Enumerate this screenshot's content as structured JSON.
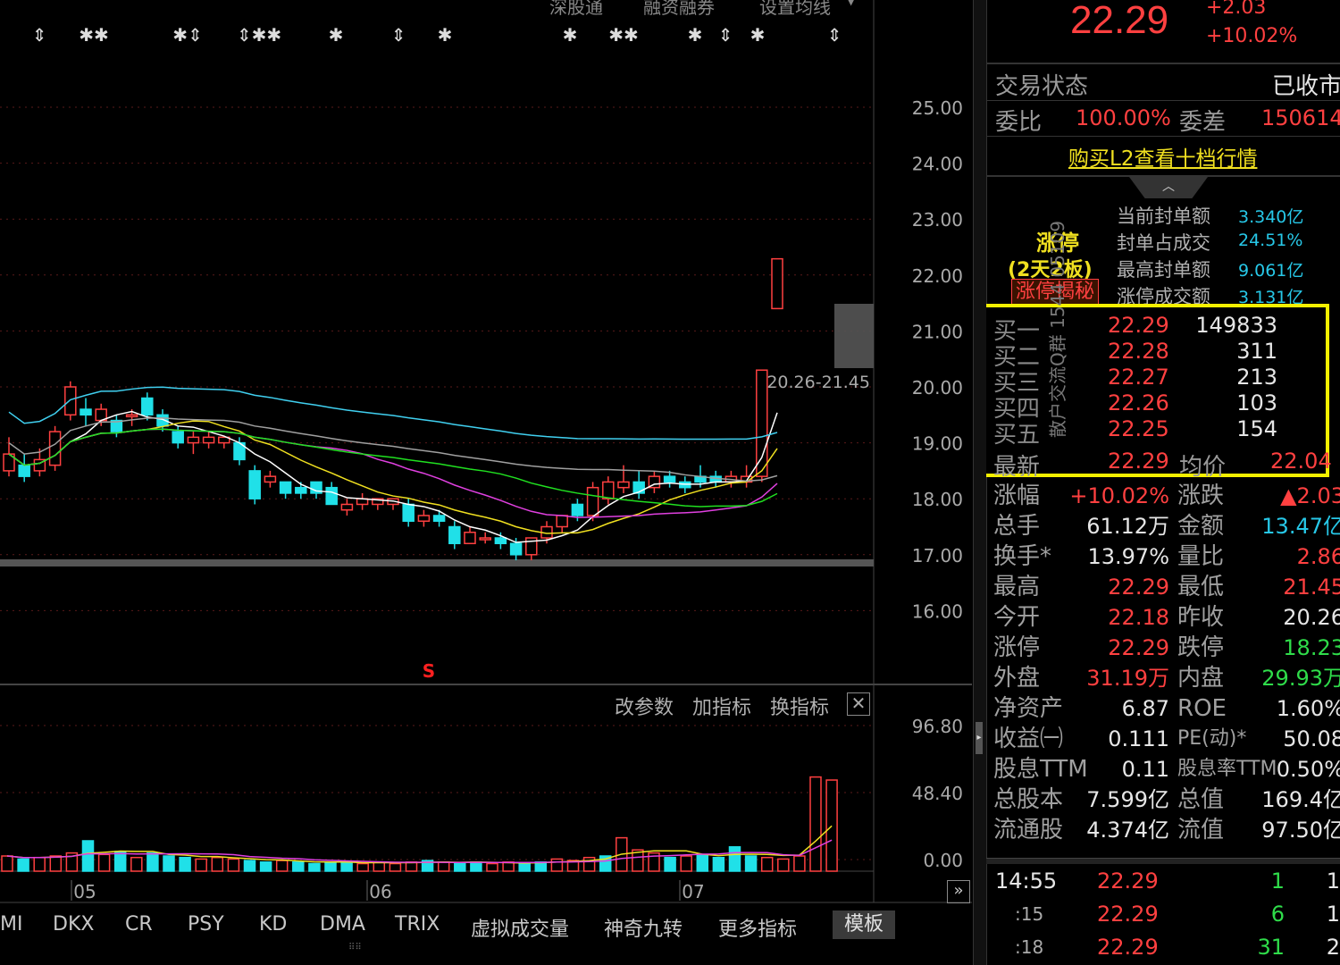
{
  "top_toolbar": {
    "items": [
      "深股通",
      "融资融券",
      "设置均线"
    ],
    "dropdown_icon": "triangle-down-icon"
  },
  "chart": {
    "price_axis": [
      "25.00",
      "24.00",
      "23.00",
      "22.00",
      "21.00",
      "20.00",
      "19.00",
      "18.00",
      "17.00",
      "16.00"
    ],
    "range_label": "20.26-21.45",
    "signal_mark": "S",
    "event_marks": [
      "⇕",
      "✱✱",
      "✱⇕",
      "⇕✱✱",
      "✱",
      "⇕",
      "✱",
      "✱",
      "✱✱",
      "✱",
      "⇕",
      "✱",
      "⇕"
    ],
    "candles": [
      [
        18.5,
        18.8,
        18.4,
        19.1
      ],
      [
        18.6,
        18.4,
        18.3,
        18.8
      ],
      [
        18.5,
        18.7,
        18.4,
        18.9
      ],
      [
        18.6,
        19.2,
        18.5,
        19.3
      ],
      [
        19.5,
        20.0,
        19.4,
        20.1
      ],
      [
        19.6,
        19.5,
        19.3,
        19.8
      ],
      [
        19.4,
        19.6,
        19.3,
        19.7
      ],
      [
        19.4,
        19.2,
        19.1,
        19.5
      ],
      [
        19.5,
        19.5,
        19.3,
        19.6
      ],
      [
        19.8,
        19.5,
        19.4,
        19.9
      ],
      [
        19.5,
        19.3,
        19.2,
        19.6
      ],
      [
        19.2,
        19.0,
        18.9,
        19.3
      ],
      [
        19.0,
        19.1,
        18.8,
        19.2
      ],
      [
        19.0,
        19.1,
        18.9,
        19.2
      ],
      [
        19.0,
        19.1,
        18.9,
        19.1
      ],
      [
        19.0,
        18.7,
        18.6,
        19.1
      ],
      [
        18.5,
        18.0,
        17.9,
        18.6
      ],
      [
        18.3,
        18.4,
        18.2,
        18.5
      ],
      [
        18.3,
        18.1,
        18.0,
        18.3
      ],
      [
        18.2,
        18.1,
        18.0,
        18.3
      ],
      [
        18.3,
        18.1,
        18.0,
        18.3
      ],
      [
        18.2,
        17.9,
        17.9,
        18.3
      ],
      [
        17.8,
        17.9,
        17.7,
        18.0
      ],
      [
        17.9,
        18.0,
        17.8,
        18.1
      ],
      [
        17.9,
        18.0,
        17.8,
        18.0
      ],
      [
        17.9,
        18.0,
        17.8,
        18.0
      ],
      [
        17.9,
        17.6,
        17.5,
        18.0
      ],
      [
        17.6,
        17.7,
        17.5,
        17.8
      ],
      [
        17.7,
        17.6,
        17.5,
        17.8
      ],
      [
        17.5,
        17.2,
        17.1,
        17.6
      ],
      [
        17.2,
        17.4,
        17.2,
        17.5
      ],
      [
        17.3,
        17.3,
        17.2,
        17.4
      ],
      [
        17.3,
        17.2,
        17.1,
        17.4
      ],
      [
        17.2,
        17.0,
        16.9,
        17.3
      ],
      [
        17.0,
        17.3,
        16.9,
        17.3
      ],
      [
        17.3,
        17.5,
        17.2,
        17.6
      ],
      [
        17.5,
        17.7,
        17.4,
        17.7
      ],
      [
        17.9,
        17.7,
        17.6,
        18.0
      ],
      [
        17.7,
        18.2,
        17.6,
        18.3
      ],
      [
        18.0,
        18.3,
        17.9,
        18.4
      ],
      [
        18.2,
        18.3,
        18.1,
        18.6
      ],
      [
        18.3,
        18.1,
        18.0,
        18.5
      ],
      [
        18.2,
        18.4,
        18.1,
        18.5
      ],
      [
        18.4,
        18.3,
        18.2,
        18.5
      ],
      [
        18.3,
        18.2,
        18.1,
        18.4
      ],
      [
        18.4,
        18.3,
        18.2,
        18.6
      ],
      [
        18.4,
        18.3,
        18.2,
        18.5
      ],
      [
        18.3,
        18.4,
        18.2,
        18.5
      ],
      [
        18.3,
        18.4,
        18.2,
        18.6
      ],
      [
        18.4,
        20.3,
        18.3,
        20.3
      ],
      [
        21.4,
        22.29,
        21.4,
        22.29
      ]
    ],
    "ma_colors": [
      "#ffffff",
      "#f0e020",
      "#e040e0",
      "#20e020",
      "#40d0f0",
      "#a0a0a0"
    ],
    "vol_axis": [
      "96.80",
      "48.40",
      "0.00"
    ],
    "vol_buttons": [
      "改参数",
      "加指标",
      "换指标"
    ],
    "volumes": [
      10,
      8,
      9,
      10,
      12,
      20,
      11,
      13,
      9,
      12,
      10,
      9,
      8,
      9,
      8,
      7,
      6,
      7,
      6,
      5,
      6,
      6,
      5,
      6,
      5,
      6,
      7,
      6,
      5,
      6,
      5,
      6,
      5,
      6,
      8,
      7,
      9,
      10,
      22,
      14,
      12,
      9,
      10,
      11,
      9,
      16,
      10,
      9,
      8,
      10,
      62,
      60
    ],
    "x_labels": [
      "05",
      "06",
      "07"
    ],
    "candle_colors": {
      "up": "#ff4040",
      "down": "#20e0e8"
    }
  },
  "bottom_tabs": [
    "MI",
    "DKX",
    "CR",
    "PSY",
    "KD",
    "DMA",
    "TRIX",
    "虚拟成交量",
    "神奇九转",
    "更多指标",
    "模板"
  ],
  "quote": {
    "price": "22.29",
    "change": "+2.03",
    "pct": "+10.02%",
    "trade_status_label": "交易状态",
    "trade_status": "已收市",
    "wb_label": "委比",
    "wb": "100.00%",
    "wc_label": "委差",
    "wc": "150614",
    "l2_link": "购买L2查看十档行情",
    "limit": {
      "title": "涨停",
      "days": "(2天2板)",
      "reveal_button": "涨停揭秘",
      "rows": [
        {
          "label": "当前封单额",
          "value": "3.340亿"
        },
        {
          "label": "封单占成交",
          "value": "24.51%"
        },
        {
          "label": "最高封单额",
          "value": "9.061亿"
        },
        {
          "label": "涨停成交额",
          "value": "3.131亿"
        }
      ]
    },
    "vertical_note": "散户交流Q群 1544 05109",
    "bids": [
      {
        "label": "买一",
        "price": "22.29",
        "vol": "149833"
      },
      {
        "label": "买二",
        "price": "22.28",
        "vol": "311"
      },
      {
        "label": "买三",
        "price": "22.27",
        "vol": "213"
      },
      {
        "label": "买四",
        "price": "22.26",
        "vol": "103"
      },
      {
        "label": "买五",
        "price": "22.25",
        "vol": "154"
      }
    ],
    "latest_label": "最新",
    "latest": "22.29",
    "avg_label": "均价",
    "avg": "22.04",
    "stats": [
      {
        "l1": "涨幅",
        "v1": "+10.02%",
        "c1": "r",
        "l2": "涨跌",
        "v2": "▲2.03",
        "c2": "r"
      },
      {
        "l1": "总手",
        "v1": "61.12万",
        "c1": "w",
        "l2": "金额",
        "v2": "13.47亿",
        "c2": "c"
      },
      {
        "l1": "换手*",
        "v1": "13.97%",
        "c1": "w",
        "l2": "量比",
        "v2": "2.86",
        "c2": "r"
      },
      {
        "l1": "最高",
        "v1": "22.29",
        "c1": "r",
        "l2": "最低",
        "v2": "21.45",
        "c2": "r"
      },
      {
        "l1": "今开",
        "v1": "22.18",
        "c1": "r",
        "l2": "昨收",
        "v2": "20.26",
        "c2": "w"
      },
      {
        "l1": "涨停",
        "v1": "22.29",
        "c1": "r",
        "l2": "跌停",
        "v2": "18.23",
        "c2": "g"
      },
      {
        "l1": "外盘",
        "v1": "31.19万",
        "c1": "r",
        "l2": "内盘",
        "v2": "29.93万",
        "c2": "g"
      },
      {
        "l1": "净资产",
        "v1": "6.87",
        "c1": "w",
        "l2": "ROE",
        "v2": "1.60%",
        "c2": "w"
      },
      {
        "l1": "收益㈠",
        "v1": "0.111",
        "c1": "w",
        "l2": "PE(动)*",
        "v2": "50.08",
        "c2": "w"
      },
      {
        "l1": "股息TTM",
        "v1": "0.11",
        "c1": "w",
        "l2": "股息率TTM",
        "v2": "0.50%",
        "c2": "w"
      },
      {
        "l1": "总股本",
        "v1": "7.599亿",
        "c1": "w",
        "l2": "总值",
        "v2": "169.4亿",
        "c2": "w"
      },
      {
        "l1": "流通股",
        "v1": "4.374亿",
        "c1": "w",
        "l2": "流值",
        "v2": "97.50亿",
        "c2": "w"
      }
    ],
    "ticks": [
      {
        "time": "14:55",
        "price": "22.29",
        "vol": "1",
        "n": "1"
      },
      {
        "time": ":15",
        "price": "22.29",
        "vol": "6",
        "n": "1"
      },
      {
        "time": ":18",
        "price": "22.29",
        "vol": "31",
        "n": "2"
      }
    ]
  },
  "colors": {
    "red": "#ff4040",
    "green": "#2fdc4a",
    "cyan": "#27c8e8",
    "yellow": "#f0e020",
    "highlight_box": "#f5f000",
    "grid": "#5a1a1a"
  }
}
